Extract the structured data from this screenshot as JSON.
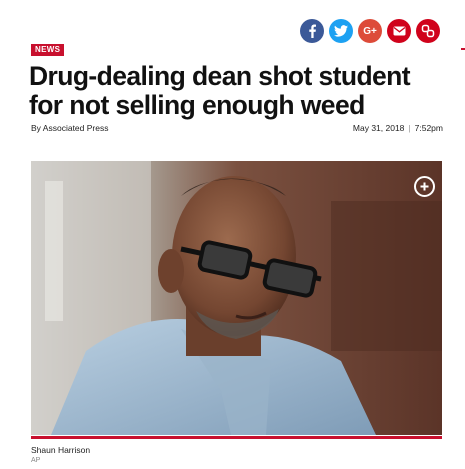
{
  "share": {
    "icons": [
      "facebook-icon",
      "twitter-icon",
      "google-plus-icon",
      "email-icon",
      "link-icon"
    ],
    "google_plus_label": "G+",
    "colors": {
      "facebook": "#3b5998",
      "twitter": "#1da1f2",
      "google_plus": "#dd4b39",
      "email": "#d0021b",
      "link": "#d0021b"
    }
  },
  "article": {
    "section": "NEWS",
    "headline": "Drug-dealing dean shot student for not selling enough weed",
    "byline": "By Associated Press",
    "date": "May 31, 2018",
    "separator": "|",
    "time": "7:52pm"
  },
  "photo": {
    "caption": "Shaun Harrison",
    "credit": "AP",
    "expand_icon": "plus-circle-icon"
  },
  "colors": {
    "accent": "#c8102e",
    "text": "#111111"
  }
}
